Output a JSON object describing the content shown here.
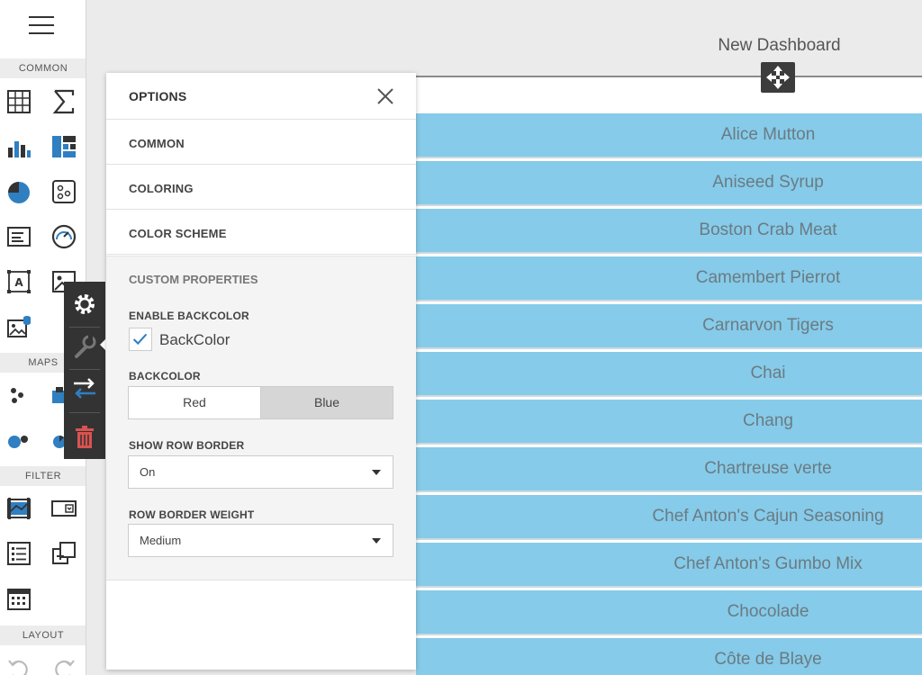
{
  "toolbox": {
    "groups": [
      "COMMON",
      "MAPS",
      "FILTER",
      "LAYOUT"
    ]
  },
  "dashboard": {
    "title": "New Dashboard"
  },
  "grid": {
    "rows": [
      "Alice Mutton",
      "Aniseed Syrup",
      "Boston Crab Meat",
      "Camembert Pierrot",
      "Carnarvon Tigers",
      "Chai",
      "Chang",
      "Chartreuse verte",
      "Chef Anton's Cajun Seasoning",
      "Chef Anton's Gumbo Mix",
      "Chocolade",
      "Côte de Blaye"
    ],
    "row_color": "#86cbe9"
  },
  "options": {
    "title": "OPTIONS",
    "sections": [
      "COMMON",
      "COLORING",
      "COLOR SCHEME"
    ],
    "custom": {
      "title": "CUSTOM PROPERTIES",
      "enable_backcolor_label": "ENABLE BACKCOLOR",
      "backcolor_checkbox_label": "BackColor",
      "backcolor_checked": true,
      "backcolor_label": "BACKCOLOR",
      "backcolor_options": [
        "Red",
        "Blue"
      ],
      "backcolor_selected": "Blue",
      "show_row_border_label": "SHOW ROW BORDER",
      "show_row_border_value": "On",
      "row_border_weight_label": "ROW BORDER WEIGHT",
      "row_border_weight_value": "Medium"
    }
  },
  "colors": {
    "accent_blue": "#2f7fc1",
    "delete_red": "#d9534f",
    "action_bar": "#333333"
  }
}
